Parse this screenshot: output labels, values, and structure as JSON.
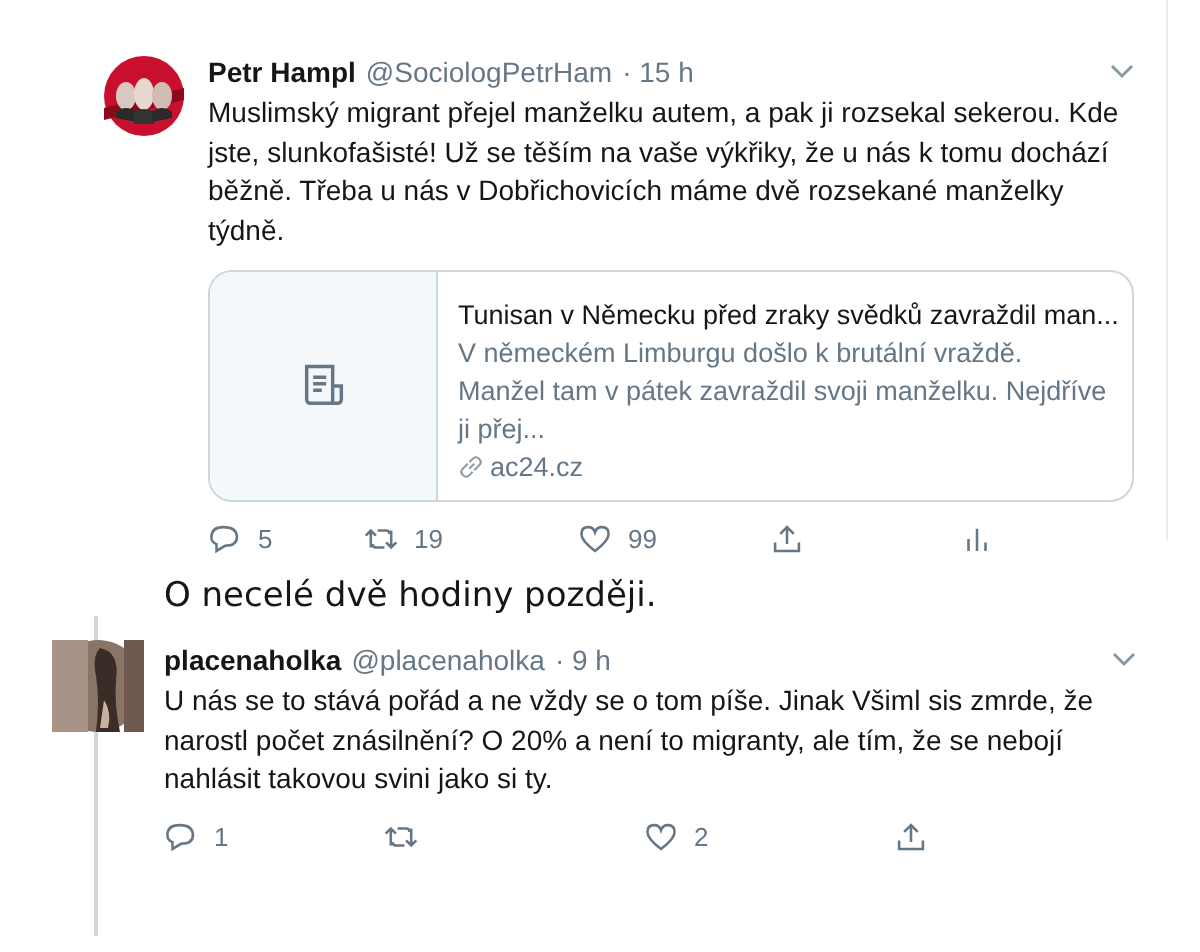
{
  "tweet": {
    "name": "Petr Hampl",
    "handle": "@SociologPetrHam",
    "time": "· 15 h",
    "text": "Muslimský migrant přejel manželku autem, a pak ji rozsekal sekerou. Kde jste, slunkofašisté! Už se těším na vaše výkřiky, že u nás k tomu dochází běžně. Třeba u nás v Dobřichovicích máme dvě rozsekané manželky týdně.",
    "card": {
      "title": "Tunisan v Německu před zraky svědků zavraždil man...",
      "description": "V německém Limburgu došlo k brutální vraždě. Manžel tam v pátek zavraždil svoji manželku. Nejdříve ji přej...",
      "domain": "ac24.cz"
    },
    "actions": [
      {
        "kind": "reply",
        "count": "5"
      },
      {
        "kind": "retweet",
        "count": "19"
      },
      {
        "kind": "like",
        "count": "99"
      },
      {
        "kind": "share"
      },
      {
        "kind": "stats"
      }
    ]
  },
  "caption": "O necelé dvě hodiny později.",
  "reply": {
    "name": "placenaholka",
    "handle": "@placenaholka",
    "time": "· 9 h",
    "text": "U nás se to stává pořád a ne vždy se o tom píše. Jinak Všiml sis zmrde, že narostl počet znásilnění? O 20% a není to migranty, ale tím, že se nebojí nahlásit takovou svini jako si ty.",
    "actions": [
      {
        "kind": "reply",
        "count": "1"
      },
      {
        "kind": "retweet"
      },
      {
        "kind": "like",
        "count": "2"
      },
      {
        "kind": "share"
      }
    ]
  }
}
